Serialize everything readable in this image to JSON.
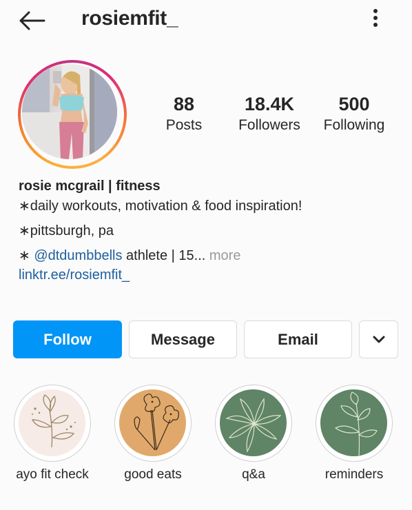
{
  "header": {
    "username": "rosiemfit_",
    "back_icon": "arrow-left-icon",
    "menu_icon": "more-vertical-icon"
  },
  "profile": {
    "avatar_ring_colors": [
      "#f58529",
      "#dd2a7b",
      "#e1306c",
      "#fcaf45"
    ],
    "stats": {
      "posts": {
        "value": "88",
        "label": "Posts"
      },
      "followers": {
        "value": "18.4K",
        "label": "Followers"
      },
      "following": {
        "value": "500",
        "label": "Following"
      }
    },
    "display_name": "rosie mcgrail | fitness",
    "bio": {
      "line1": "∗daily workouts, motivation & food inspiration!",
      "line2": "∗pittsburgh, pa",
      "line3_prefix": "∗ ",
      "line3_mention": "@dtdumbbells",
      "line3_text": " athlete | 15...",
      "line3_more": " more",
      "link": "linktr.ee/rosiemfit_"
    }
  },
  "actions": {
    "follow": "Follow",
    "message": "Message",
    "email": "Email",
    "chevron_icon": "chevron-down-icon",
    "follow_color": "#0095f6"
  },
  "highlights": [
    {
      "label": "ayo fit check",
      "bg": "#f6ebe6",
      "icon": "leaf-sprig-icon"
    },
    {
      "label": "good eats",
      "bg": "#e0a96b",
      "icon": "flowers-icon"
    },
    {
      "label": "q&a",
      "bg": "#5f8466",
      "icon": "palm-leaf-icon"
    },
    {
      "label": "reminders",
      "bg": "#5f8466",
      "icon": "leafy-branch-icon"
    }
  ]
}
